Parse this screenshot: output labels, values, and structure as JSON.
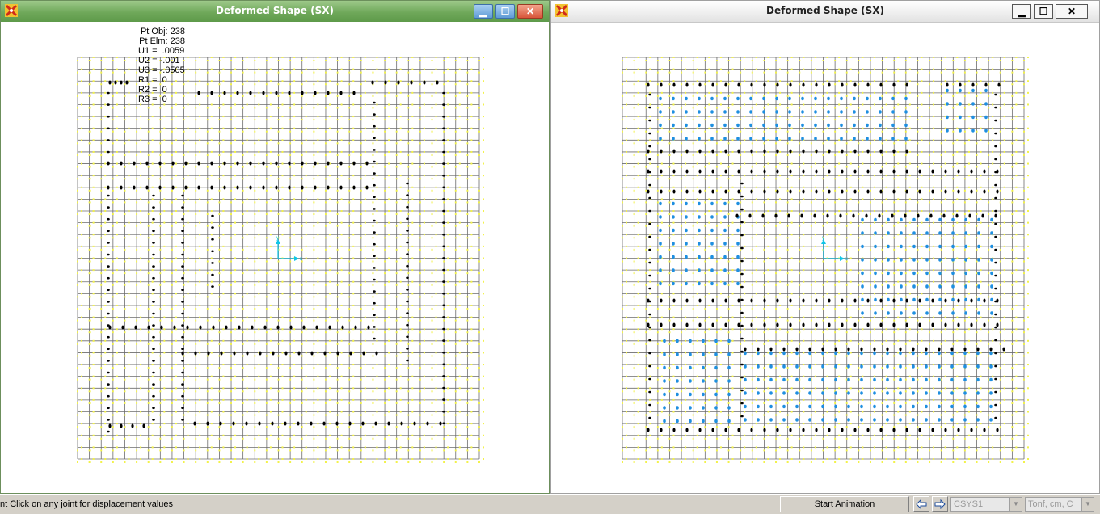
{
  "left_window": {
    "title": "Deformed Shape (SX)",
    "readout": {
      "pt_obj": "Pt Obj: 238",
      "pt_elm": "Pt Elm: 238",
      "u1": "U1 =  .0059",
      "u2": "U2 = -.001",
      "u3": "U3 = -.0505",
      "r1": "R1 =  0",
      "r2": "R2 =  0",
      "r3": "R3 =  0"
    },
    "axis_x": "x",
    "axis_y": "y"
  },
  "right_window": {
    "title": "Deformed Shape (SX)",
    "axis_x": "x",
    "axis_y": "y"
  },
  "window_buttons": {
    "minimize": "▁",
    "maximize": "☐",
    "close": "✕"
  },
  "status": {
    "message": "nt Click on any joint for displacement values",
    "start_animation": "Start Animation",
    "coord_system": "CSYS1",
    "units": "Tonf, cm, C"
  },
  "colors": {
    "grid": "#6b6b6b",
    "mesh_points": "#f2f24a",
    "deformed_points": "#000000",
    "shell_points": "#1f8fe0",
    "axes": "#11c6e8"
  }
}
